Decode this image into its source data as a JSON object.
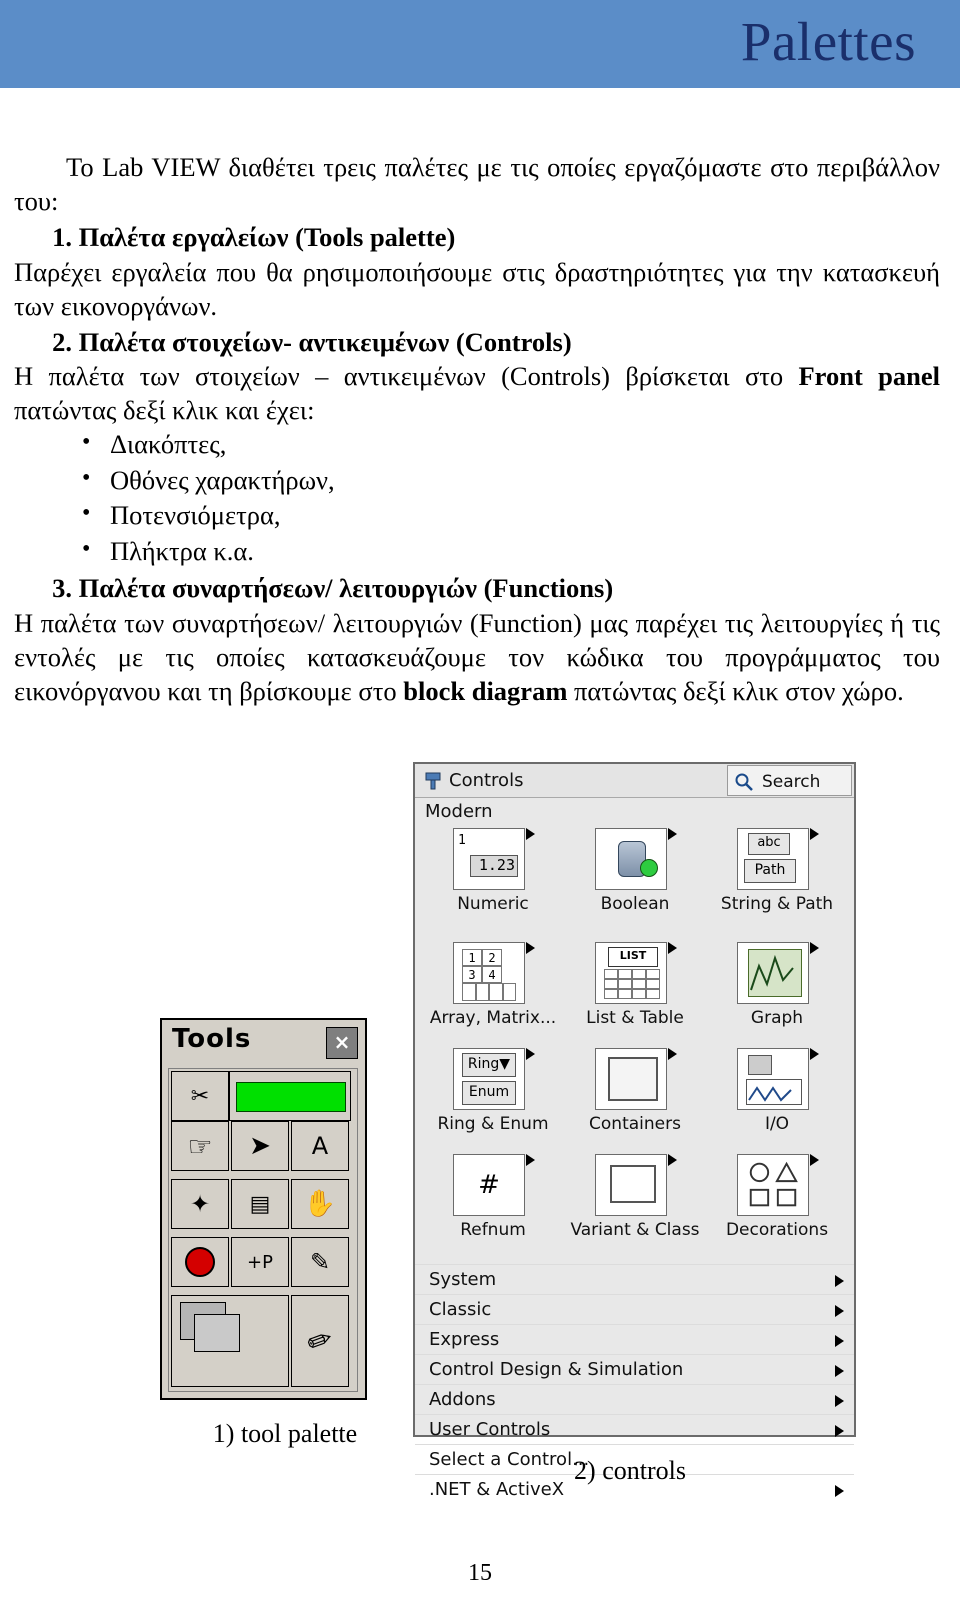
{
  "header": {
    "title": "Palettes"
  },
  "body": {
    "intro_line1": "Το Lab VIEW διαθέτει τρεις παλέτες με τις οποίες εργαζόμαστε",
    "intro_line2": "στο περιβάλλον του:",
    "item1_num": "1.",
    "item1_head": "Παλέτα εργαλείων (Tools palette)",
    "item1_text": "Παρέχει εργαλεία που θα ρησιμοποιήσουμε στις δραστηριότητες για την κατασκευή των εικονοργάνων.",
    "item2_num": "2.",
    "item2_head": "Παλέτα στοιχείων- αντικειμένων (Controls)",
    "item2_text_a": "Η παλέτα των στοιχείων – αντικειμένων (Controls) βρίσκεται  στο ",
    "item2_text_b": "Front panel",
    "item2_text_c": " πατώντας δεξί κλικ και  έχει:",
    "bullets": [
      "Διακόπτες,",
      "Οθόνες χαρακτήρων,",
      "Ποτενσιόμετρα,",
      "Πλήκτρα κ.α."
    ],
    "item3_num": "3.",
    "item3_head": "Παλέτα συναρτήσεων/ λειτουργιών (Functions)",
    "item3_text_a": "Η παλέτα των συναρτήσεων/ λειτουργιών (Function) μας παρέχει τις λειτουργίες ή τις εντολές με τις οποίες κατασκευάζουμε τον κώδικα του προγράμματος του εικονόργανου και τη βρίσκουμε στο ",
    "item3_text_b": "block diagram",
    "item3_text_c": " πατώντας δεξί κλικ στον χώρο."
  },
  "tools_palette": {
    "title": "Tools",
    "close_label": "×",
    "cells": [
      {
        "name": "operate-value-tool",
        "glyph": "✂"
      },
      {
        "name": "led-indicator",
        "glyph": ""
      },
      {
        "name": "hand-tool",
        "glyph": "☞"
      },
      {
        "name": "positioning-tool",
        "glyph": "➚"
      },
      {
        "name": "labeling-tool",
        "glyph": "A"
      },
      {
        "name": "wiring-tool",
        "glyph": "✎"
      },
      {
        "name": "object-shortcut-menu-tool",
        "glyph": "▤"
      },
      {
        "name": "scroll-tool",
        "glyph": "✋"
      },
      {
        "name": "breakpoint-tool",
        "glyph": "●"
      },
      {
        "name": "probe-tool",
        "glyph": "+P"
      },
      {
        "name": "color-copy-tool",
        "glyph": "✐"
      },
      {
        "name": "color-tool",
        "glyph": "🖌"
      }
    ],
    "caption": "1)  tool palette"
  },
  "controls_palette": {
    "pin_icon": "pin-icon",
    "title": "Controls",
    "search_icon": "search-icon",
    "search_label": "Search",
    "category": "Modern",
    "icons": [
      {
        "label": "Numeric",
        "art": "numeric"
      },
      {
        "label": "Boolean",
        "art": "boolean"
      },
      {
        "label": "String & Path",
        "art": "string"
      },
      {
        "label": "Array, Matrix...",
        "art": "array"
      },
      {
        "label": "List & Table",
        "art": "list"
      },
      {
        "label": "Graph",
        "art": "graph"
      },
      {
        "label": "Ring & Enum",
        "art": "ring"
      },
      {
        "label": "Containers",
        "art": "containers"
      },
      {
        "label": "I/O",
        "art": "io"
      },
      {
        "label": "Refnum",
        "art": "refnum"
      },
      {
        "label": "Variant & Class",
        "art": "variant"
      },
      {
        "label": "Decorations",
        "art": "decorations"
      }
    ],
    "rows": [
      "System",
      "Classic",
      "Express",
      "Control Design & Simulation",
      "Addons",
      "User Controls",
      "Select a Control...",
      ".NET & ActiveX"
    ],
    "caption": "2) controls"
  },
  "page_number": "15"
}
